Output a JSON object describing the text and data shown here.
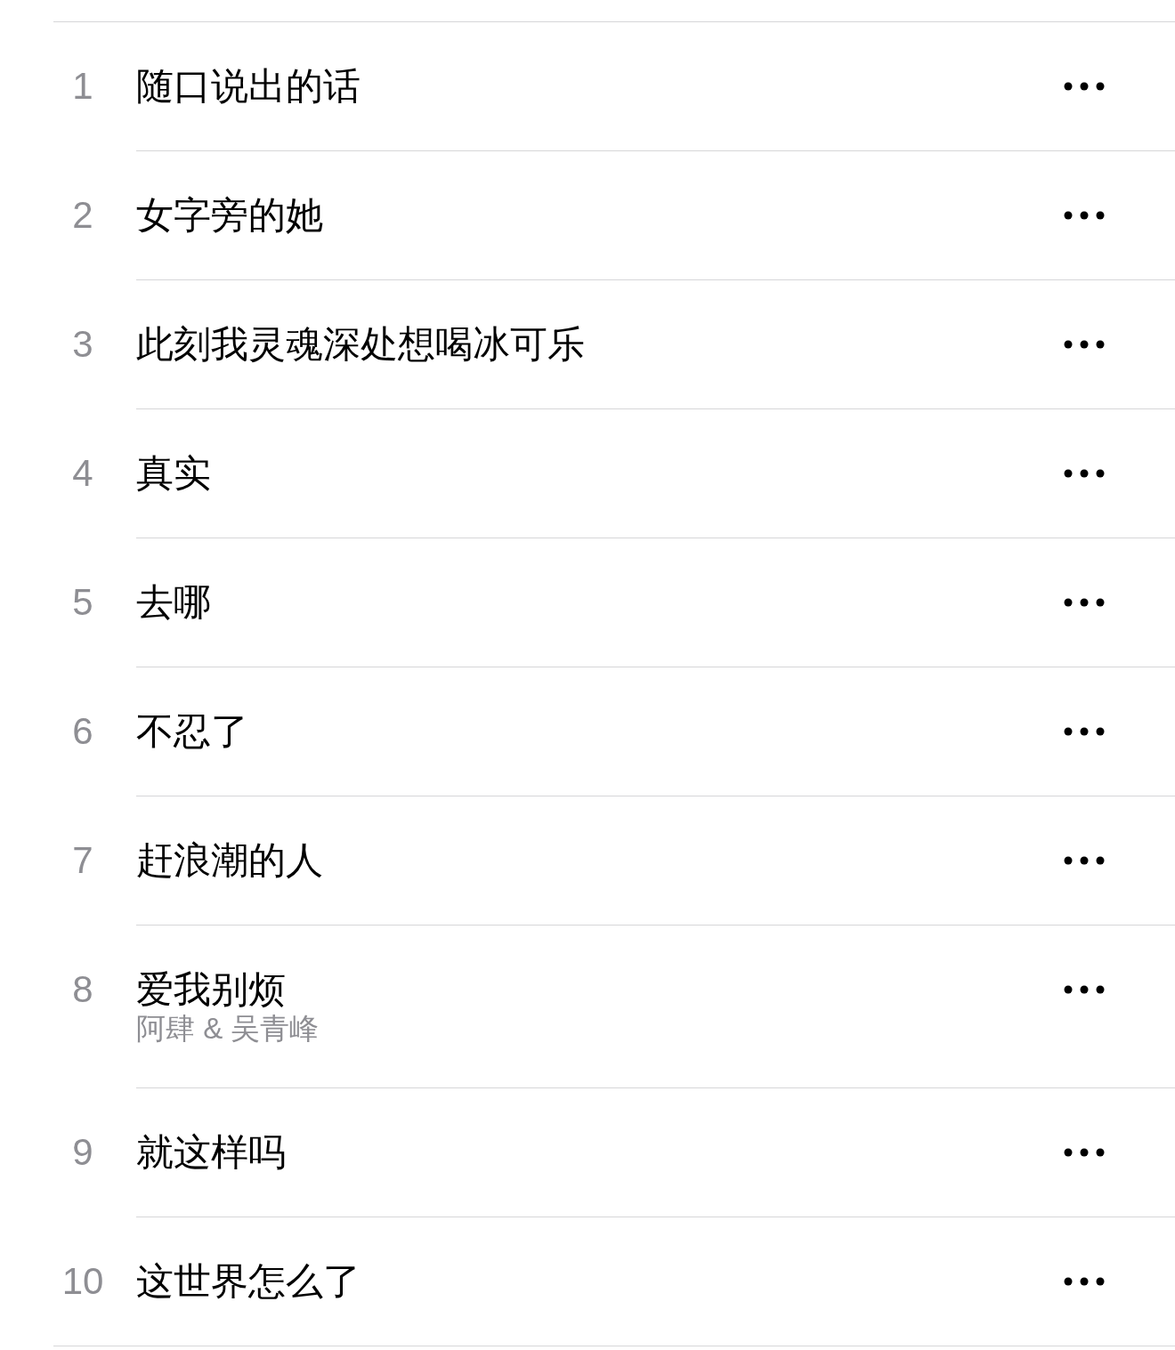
{
  "tracks": [
    {
      "number": "1",
      "title": "随口说出的话"
    },
    {
      "number": "2",
      "title": "女字旁的她"
    },
    {
      "number": "3",
      "title": "此刻我灵魂深处想喝冰可乐"
    },
    {
      "number": "4",
      "title": "真实"
    },
    {
      "number": "5",
      "title": "去哪"
    },
    {
      "number": "6",
      "title": "不忍了"
    },
    {
      "number": "7",
      "title": "赶浪潮的人"
    },
    {
      "number": "8",
      "title": "爱我别烦",
      "artist": "阿肆 & 吴青峰"
    },
    {
      "number": "9",
      "title": "就这样吗"
    },
    {
      "number": "10",
      "title": "这世界怎么了"
    }
  ]
}
